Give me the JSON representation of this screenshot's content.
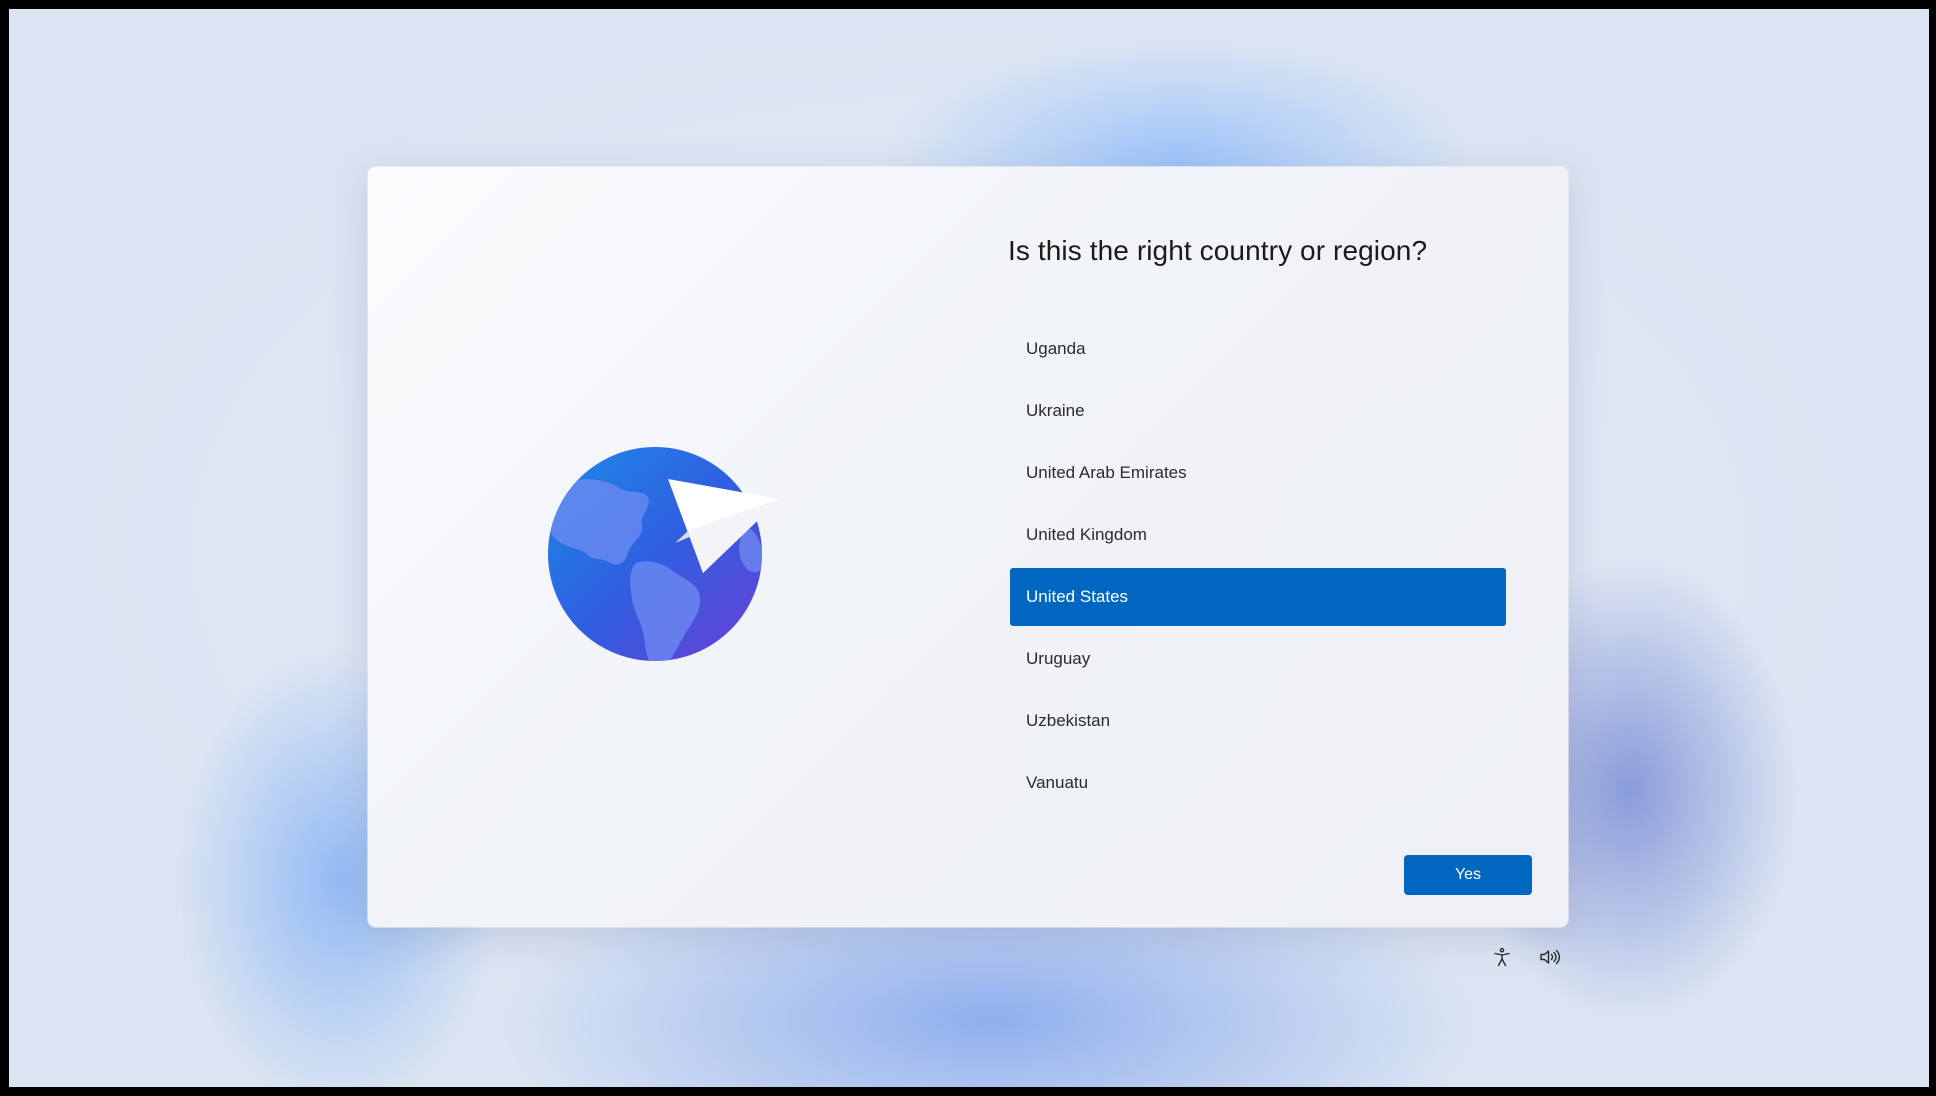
{
  "dialog": {
    "title": "Is this the right country or region?",
    "countries": [
      {
        "label": "Uganda",
        "selected": false
      },
      {
        "label": "Ukraine",
        "selected": false
      },
      {
        "label": "United Arab Emirates",
        "selected": false
      },
      {
        "label": "United Kingdom",
        "selected": false
      },
      {
        "label": "United States",
        "selected": true
      },
      {
        "label": "Uruguay",
        "selected": false
      },
      {
        "label": "Uzbekistan",
        "selected": false
      },
      {
        "label": "Vanuatu",
        "selected": false
      }
    ],
    "yes_label": "Yes"
  },
  "icons": {
    "illustration": "globe-paper-plane-icon",
    "accessibility": "accessibility-icon",
    "volume": "volume-icon"
  },
  "colors": {
    "accent": "#0067c0",
    "selected_text": "#ffffff",
    "globe_blue": "#2f6fe0",
    "globe_purple": "#6a3fd6"
  }
}
